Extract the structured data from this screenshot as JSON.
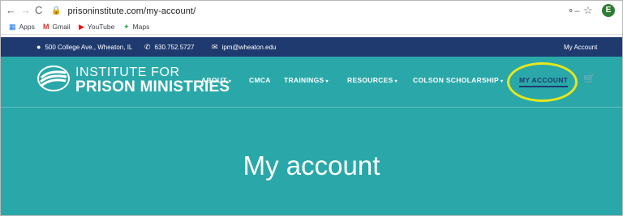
{
  "browser": {
    "url": "prisoninstitute.com/my-account/",
    "profile_initial": "E",
    "bookmarks": [
      {
        "label": "Apps",
        "icon": "apps-grid-icon"
      },
      {
        "label": "Gmail",
        "icon": "gmail-icon"
      },
      {
        "label": "YouTube",
        "icon": "youtube-icon"
      },
      {
        "label": "Maps",
        "icon": "maps-icon"
      }
    ]
  },
  "topbar": {
    "address": "500 College Ave., Wheaton, IL",
    "phone": "630.752.5727",
    "email": "ipm@wheaton.edu",
    "account_link": "My Account"
  },
  "site": {
    "logo_line1": "INSTITUTE FOR",
    "logo_line2": "PRISON MINISTRIES",
    "nav": [
      {
        "label": "ABOUT",
        "dropdown": true
      },
      {
        "label": "CMCA",
        "dropdown": false
      },
      {
        "label": "TRAININGS",
        "dropdown": true
      },
      {
        "label": "RESOURCES",
        "dropdown": true
      },
      {
        "label": "COLSON SCHOLARSHIP",
        "dropdown": true
      },
      {
        "label": "MY ACCOUNT",
        "dropdown": false,
        "active": true
      }
    ],
    "page_title": "My account"
  },
  "colors": {
    "topbar_bg": "#1e3a6e",
    "hero_bg": "#2aa8a9",
    "highlight": "#e6e61d",
    "active_nav": "#1e3a6e"
  }
}
